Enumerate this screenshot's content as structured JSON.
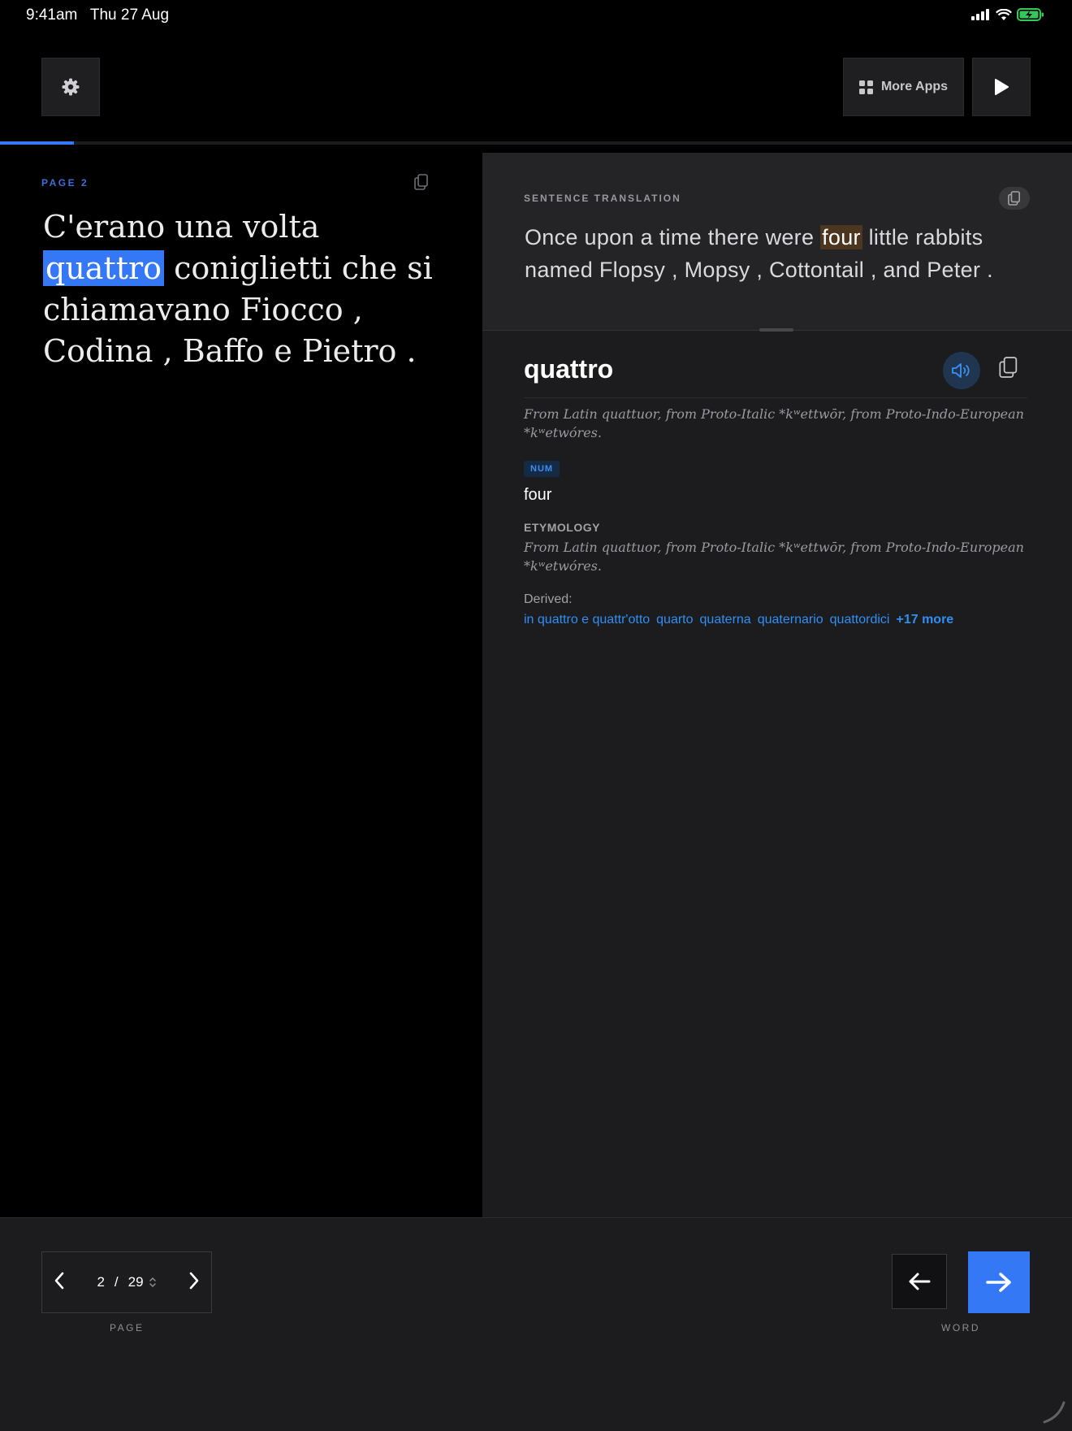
{
  "status_bar": {
    "time": "9:41am",
    "date": "Thu 27 Aug"
  },
  "toolbar": {
    "more_apps_label": "More Apps"
  },
  "progress": {
    "fraction": 0.069,
    "accent_color": "#3478f6"
  },
  "reader": {
    "page_label": "PAGE 2",
    "source_before": "C'erano una volta ",
    "source_highlight": "quattro",
    "source_after": " coniglietti che si chiamavano Fiocco , Codina , Baffo e Pietro ."
  },
  "translation": {
    "label": "SENTENCE TRANSLATION",
    "text_before": "Once upon a time there were ",
    "text_highlight": "four",
    "text_after": " little rabbits named Flopsy , Mopsy , Cottontail , and Peter ."
  },
  "entry": {
    "word": "quattro",
    "etymology_short": "From Latin quattuor, from Proto-Italic *kʷettwōr, from Proto-Indo-European *kʷetwóres.",
    "pos": "NUM",
    "definition": "four",
    "etymology_label": "ETYMOLOGY",
    "etymology_long": "From Latin quattuor, from Proto-Italic *kʷettwōr, from Proto-Indo-European *kʷetwóres.",
    "derived_label": "Derived:",
    "derived": [
      "in quattro e quattr'otto",
      "quarto",
      "quaterna",
      "quaternario",
      "quattordici"
    ],
    "derived_more": "+17 more"
  },
  "pager": {
    "current": "2",
    "separator": "/",
    "total": "29",
    "caption": "PAGE"
  },
  "word_nav": {
    "caption": "WORD"
  },
  "icons": {
    "settings": "gear-icon",
    "more_apps": "grid-icon",
    "play": "play-icon",
    "copy": "copy-icon",
    "speaker": "speaker-icon",
    "prev": "chevron-left-icon",
    "next": "chevron-right-icon",
    "back_arrow": "arrow-left-icon",
    "forward_arrow": "arrow-right-icon"
  }
}
